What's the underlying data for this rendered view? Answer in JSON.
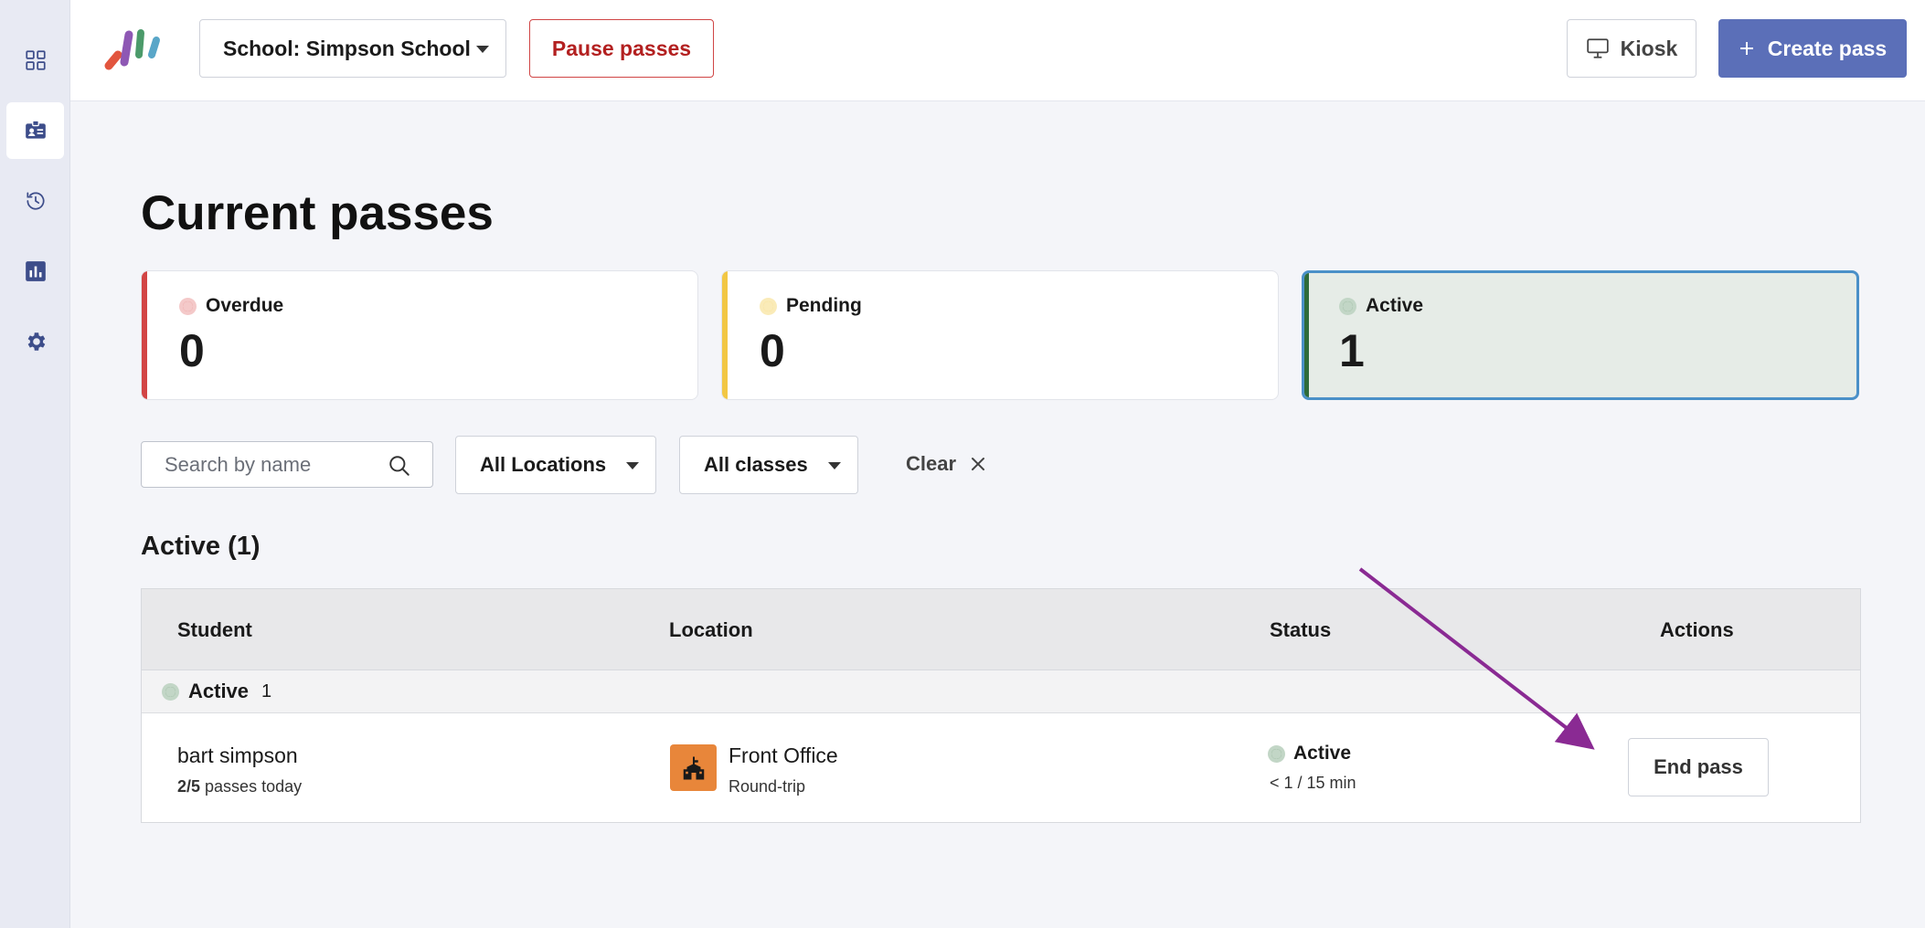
{
  "colors": {
    "overdue": "#d24545",
    "pending": "#f2c744",
    "active": "#2f6b3a",
    "brand": "#5b6fb8",
    "pause": "#b32020",
    "annotation_arrow": "#8a2a93"
  },
  "sidebar": {
    "items": [
      {
        "icon": "grid-icon"
      },
      {
        "icon": "id-card-icon",
        "active": true
      },
      {
        "icon": "history-icon"
      },
      {
        "icon": "bar-chart-icon"
      },
      {
        "icon": "gear-icon"
      }
    ]
  },
  "header": {
    "school_select": "School: Simpson School",
    "pause_label": "Pause passes",
    "kiosk_label": "Kiosk",
    "create_label": "Create pass"
  },
  "main": {
    "title": "Current passes",
    "summary": [
      {
        "label": "Overdue",
        "count": "0"
      },
      {
        "label": "Pending",
        "count": "0"
      },
      {
        "label": "Active",
        "count": "1"
      }
    ],
    "filters": {
      "search_placeholder": "Search by name",
      "locations": "All Locations",
      "classes": "All classes",
      "clear": "Clear"
    },
    "section_title": "Active (1)",
    "table": {
      "headers": [
        "Student",
        "Location",
        "Status",
        "Actions"
      ],
      "group": {
        "label": "Active",
        "count": "1"
      },
      "rows": [
        {
          "student": "bart simpson",
          "passes_count": "2/5",
          "passes_suffix": " passes today",
          "location": "Front Office",
          "location_type": "Round-trip",
          "status": "Active",
          "status_detail": "< 1 / 15 min",
          "action": "End pass"
        }
      ]
    }
  }
}
